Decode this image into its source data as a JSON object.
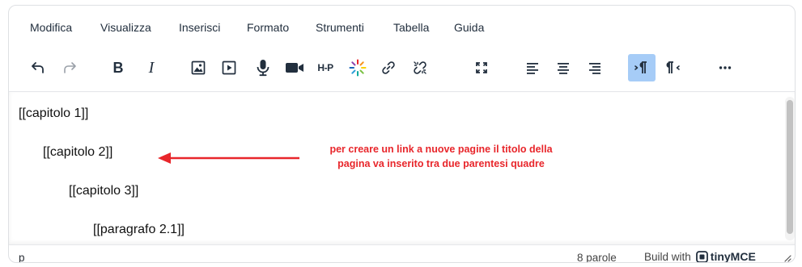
{
  "menubar": {
    "items": [
      "Modifica",
      "Visualizza",
      "Inserisci",
      "Formato",
      "Strumenti",
      "Tabella",
      "Guida"
    ]
  },
  "toolbar": {
    "buttons": [
      {
        "name": "undo-icon",
        "state": "enabled"
      },
      {
        "name": "redo-icon",
        "state": "disabled"
      },
      {
        "name": "bold-icon",
        "label": "B"
      },
      {
        "name": "italic-icon",
        "label": "I"
      },
      {
        "name": "image-icon"
      },
      {
        "name": "media-icon"
      },
      {
        "name": "microphone-icon"
      },
      {
        "name": "video-camera-icon"
      },
      {
        "name": "h5p-icon",
        "label": "H-P"
      },
      {
        "name": "loading-spinner-icon"
      },
      {
        "name": "link-icon"
      },
      {
        "name": "unlink-icon"
      },
      {
        "name": "fullscreen-icon"
      },
      {
        "name": "align-left-icon"
      },
      {
        "name": "align-center-icon"
      },
      {
        "name": "align-right-icon"
      },
      {
        "name": "ltr-icon",
        "state": "active"
      },
      {
        "name": "rtl-icon"
      },
      {
        "name": "more-icon"
      }
    ],
    "bold_label": "B",
    "italic_label": "I",
    "h5p_label": "H-P"
  },
  "content": {
    "lines": [
      "[[capitolo 1]]",
      "[[capitolo 2]]",
      "[[capitolo 3]]",
      "[[paragrafo 2.1]]"
    ],
    "annotation_line1": "per creare un link a nuove pagine il titolo della",
    "annotation_line2": "pagina va inserito tra due parentesi quadre",
    "annotation_color": "#e8262b"
  },
  "statusbar": {
    "path": "p",
    "wordcount": "8 parole",
    "branding_prefix": "Build with",
    "brand": "tinyMCE"
  },
  "colors": {
    "active_button_bg": "#a6ccf7",
    "text": "#222f3e",
    "border": "#dee0e3"
  }
}
